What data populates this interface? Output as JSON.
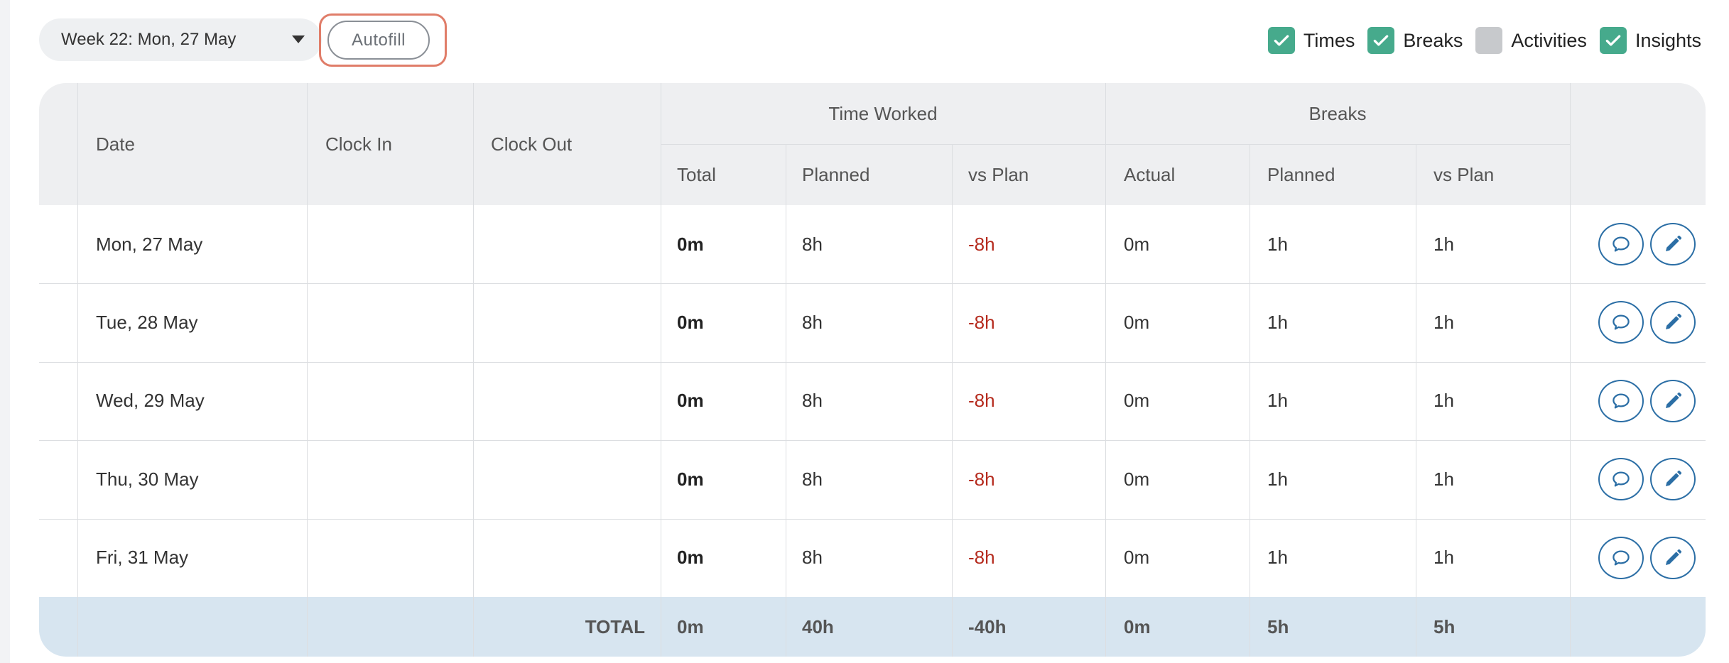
{
  "toolbar": {
    "week_selector": "Week 22: Mon, 27 May",
    "autofill_label": "Autofill",
    "toggles": [
      {
        "label": "Times",
        "checked": true
      },
      {
        "label": "Breaks",
        "checked": true
      },
      {
        "label": "Activities",
        "checked": false
      },
      {
        "label": "Insights",
        "checked": true
      }
    ]
  },
  "table": {
    "headers": {
      "date": "Date",
      "clock_in": "Clock In",
      "clock_out": "Clock Out",
      "time_worked_group": "Time Worked",
      "breaks_group": "Breaks",
      "tw_total": "Total",
      "tw_planned": "Planned",
      "tw_vs_plan": "vs Plan",
      "br_actual": "Actual",
      "br_planned": "Planned",
      "br_vs_plan": "vs Plan"
    },
    "rows": [
      {
        "date": "Mon, 27 May",
        "clock_in": "",
        "clock_out": "",
        "tw_total": "0m",
        "tw_planned": "8h",
        "tw_vs_plan": "-8h",
        "br_actual": "0m",
        "br_planned": "1h",
        "br_vs_plan": "1h"
      },
      {
        "date": "Tue, 28 May",
        "clock_in": "",
        "clock_out": "",
        "tw_total": "0m",
        "tw_planned": "8h",
        "tw_vs_plan": "-8h",
        "br_actual": "0m",
        "br_planned": "1h",
        "br_vs_plan": "1h"
      },
      {
        "date": "Wed, 29 May",
        "clock_in": "",
        "clock_out": "",
        "tw_total": "0m",
        "tw_planned": "8h",
        "tw_vs_plan": "-8h",
        "br_actual": "0m",
        "br_planned": "1h",
        "br_vs_plan": "1h"
      },
      {
        "date": "Thu, 30 May",
        "clock_in": "",
        "clock_out": "",
        "tw_total": "0m",
        "tw_planned": "8h",
        "tw_vs_plan": "-8h",
        "br_actual": "0m",
        "br_planned": "1h",
        "br_vs_plan": "1h"
      },
      {
        "date": "Fri, 31 May",
        "clock_in": "",
        "clock_out": "",
        "tw_total": "0m",
        "tw_planned": "8h",
        "tw_vs_plan": "-8h",
        "br_actual": "0m",
        "br_planned": "1h",
        "br_vs_plan": "1h"
      }
    ],
    "total": {
      "label": "TOTAL",
      "tw_total": "0m",
      "tw_planned": "40h",
      "tw_vs_plan": "-40h",
      "br_actual": "0m",
      "br_planned": "5h",
      "br_vs_plan": "5h"
    }
  },
  "icons": {
    "comment": "comment-icon",
    "edit": "pencil-icon",
    "check": "check-icon",
    "caret": "caret-down-icon"
  },
  "colors": {
    "checkbox_on": "#46aa8c",
    "checkbox_off": "#c7c9cc",
    "negative": "#b52a1d",
    "action_blue": "#2b6ea5",
    "autofill_focus": "#e07d69",
    "total_row": "#d7e5f0"
  }
}
